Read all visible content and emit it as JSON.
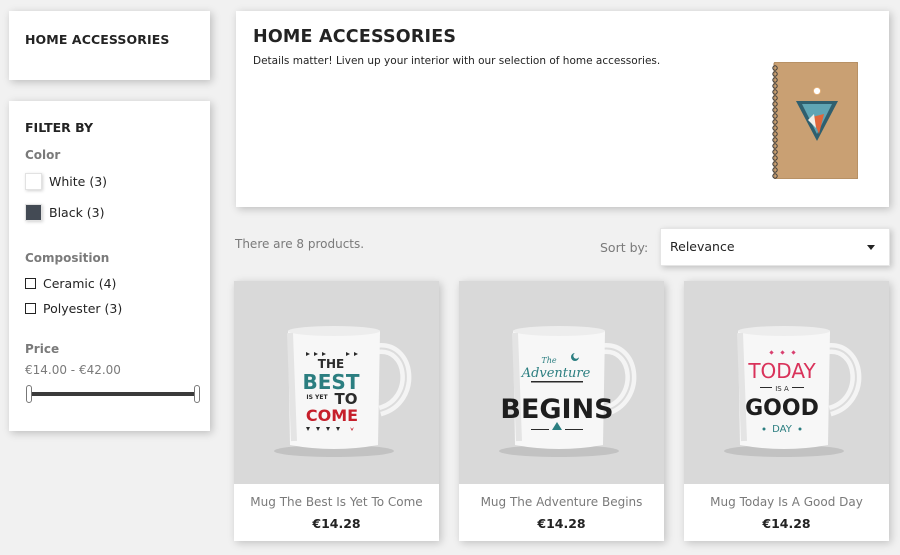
{
  "category": {
    "title": "HOME ACCESSORIES"
  },
  "filters": {
    "title": "FILTER BY",
    "color": {
      "label": "Color",
      "options": [
        {
          "label": "White (3)",
          "swatch": "#ffffff"
        },
        {
          "label": "Black (3)",
          "swatch": "#434a54"
        }
      ]
    },
    "composition": {
      "label": "Composition",
      "options": [
        {
          "label": "Ceramic (4)"
        },
        {
          "label": "Polyester (3)"
        }
      ]
    },
    "price": {
      "label": "Price",
      "range": "€14.00 - €42.00"
    }
  },
  "header": {
    "title": "HOME ACCESSORIES",
    "description": "Details matter! Liven up your interior with our selection of home accessories."
  },
  "listing": {
    "count_text": "There are 8 products.",
    "sort_label": "Sort by:",
    "sort_value": "Relevance"
  },
  "products": [
    {
      "name": "Mug The Best Is Yet To Come",
      "price": "€14.28"
    },
    {
      "name": "Mug The Adventure Begins",
      "price": "€14.28"
    },
    {
      "name": "Mug Today Is A Good Day",
      "price": "€14.28"
    }
  ]
}
